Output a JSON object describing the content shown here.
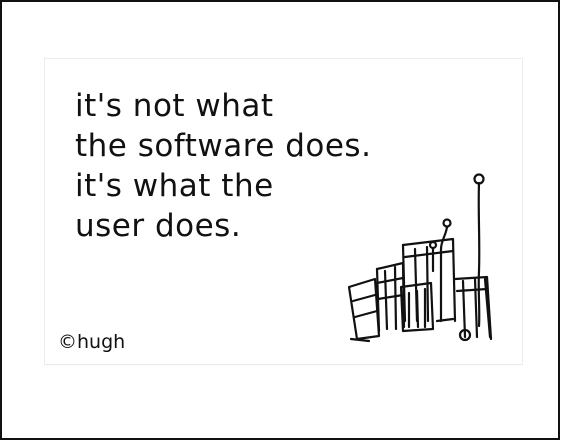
{
  "cartoon": {
    "quote_lines": [
      "it's not what",
      "the software does.",
      "it's what the",
      "user does."
    ],
    "signature": "©hugh",
    "illustration": "hand-drawn-city-icon"
  }
}
